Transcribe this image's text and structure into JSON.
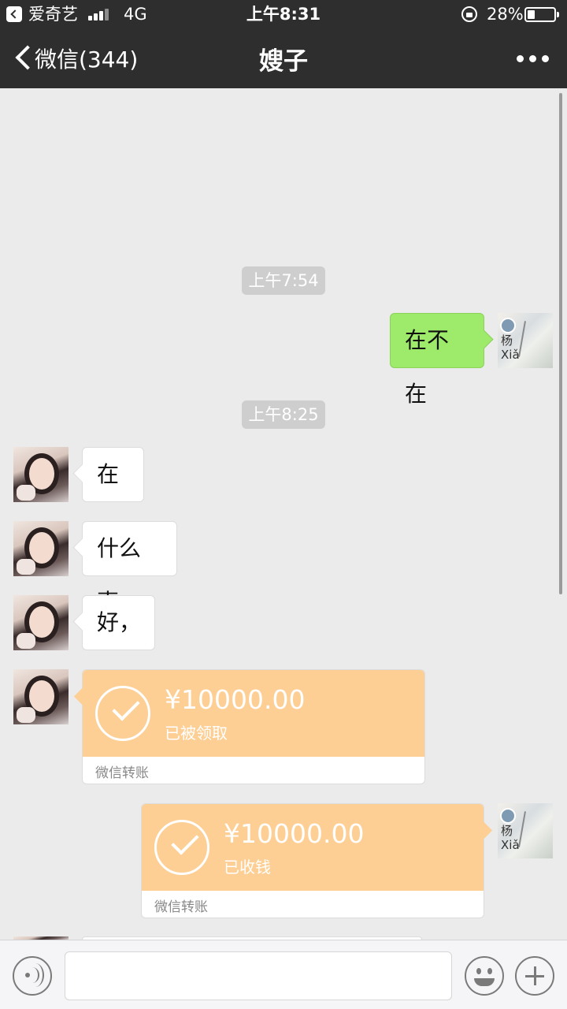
{
  "status_bar": {
    "app_name": "爱奇艺",
    "network": "4G",
    "time": "上午8:31",
    "battery_pct": "28%",
    "battery_level": 0.28
  },
  "nav": {
    "back_label": "微信(344)",
    "title": "嫂子"
  },
  "chat": {
    "timestamps": [
      "上午7:54",
      "上午8:25"
    ],
    "messages": [
      {
        "side": "out",
        "type": "text",
        "text": "在不在"
      },
      {
        "side": "in",
        "type": "text",
        "text": "在"
      },
      {
        "side": "in",
        "type": "text",
        "text": "什么事"
      },
      {
        "side": "in",
        "type": "text",
        "text": "好，"
      },
      {
        "side": "in",
        "type": "transfer",
        "amount": "¥10000.00",
        "status": "已被领取",
        "footer": "微信转账"
      },
      {
        "side": "out",
        "type": "transfer",
        "amount": "¥10000.00",
        "status": "已收钱",
        "footer": "微信转账"
      }
    ],
    "my_avatar_text": "杨\nXiǎ"
  },
  "colors": {
    "header_bg": "#2e2e2e",
    "chat_bg": "#ebebeb",
    "outgoing_bubble": "#9eea6a",
    "transfer_orange": "#fdcf94"
  },
  "icons": [
    "back-chevron-icon",
    "more-icon",
    "voice-icon",
    "emoji-icon",
    "plus-icon"
  ]
}
